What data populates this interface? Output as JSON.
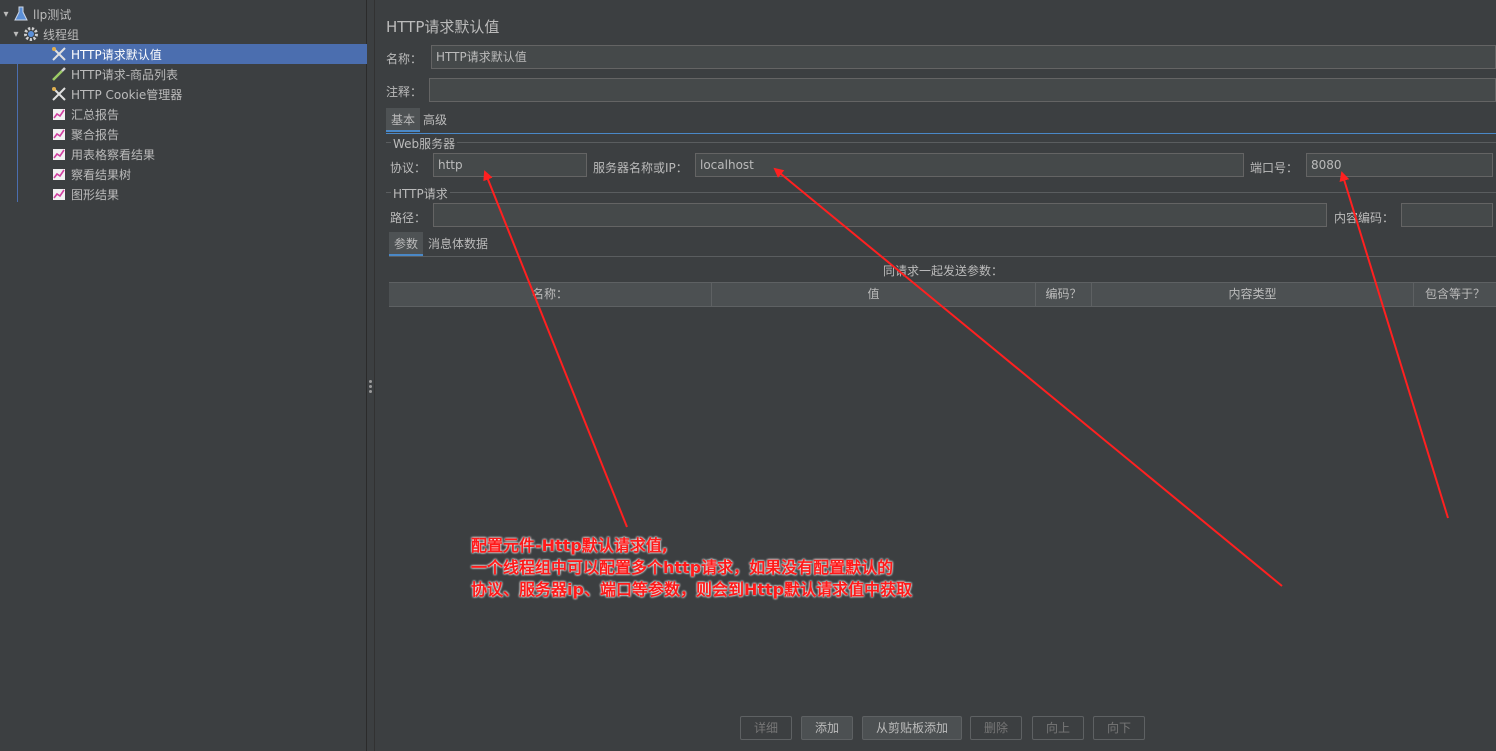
{
  "tree": {
    "items": [
      {
        "label": "llp测试",
        "icon": "test-plan-icon"
      },
      {
        "label": "线程组",
        "icon": "gear-icon"
      },
      {
        "label": "HTTP请求默认值",
        "icon": "wrench-icon"
      },
      {
        "label": "HTTP请求-商品列表",
        "icon": "pipette-icon"
      },
      {
        "label": "HTTP Cookie管理器",
        "icon": "wrench-icon"
      },
      {
        "label": "汇总报告",
        "icon": "graph-icon"
      },
      {
        "label": "聚合报告",
        "icon": "graph-icon"
      },
      {
        "label": "用表格察看结果",
        "icon": "graph-icon"
      },
      {
        "label": "察看结果树",
        "icon": "graph-icon"
      },
      {
        "label": "图形结果",
        "icon": "graph-icon"
      }
    ]
  },
  "panel": {
    "title": "HTTP请求默认值",
    "name_label": "名称：",
    "name_value": "HTTP请求默认值",
    "comment_label": "注释：",
    "comment_value": "",
    "tabs": [
      "基本",
      "高级"
    ],
    "web_server": {
      "group_title": "Web服务器",
      "protocol_label": "协议：",
      "protocol_value": "http",
      "server_label": "服务器名称或IP：",
      "server_value": "localhost",
      "port_label": "端口号：",
      "port_value": "8080"
    },
    "http_request": {
      "group_title": "HTTP请求",
      "path_label": "路径：",
      "path_value": "",
      "encoding_label": "内容编码：",
      "encoding_value": ""
    },
    "sub_tabs": [
      "参数",
      "消息体数据"
    ],
    "params_caption": "同请求一起发送参数：",
    "columns": [
      "名称：",
      "值",
      "编码？",
      "内容类型",
      "包含等于？"
    ],
    "buttons": [
      {
        "label": "详细",
        "enabled": false
      },
      {
        "label": "添加",
        "enabled": true
      },
      {
        "label": "从剪贴板添加",
        "enabled": true
      },
      {
        "label": "删除",
        "enabled": false
      },
      {
        "label": "向上",
        "enabled": false
      },
      {
        "label": "向下",
        "enabled": false
      }
    ]
  },
  "annotation": {
    "lines": [
      "配置元件-Http默认请求值,",
      "一个线程组中可以配置多个http请求，如果没有配置默认的",
      "协议、服务器ip、端口等参数，则会到Http默认请求值中获取"
    ],
    "color": "#ff1a1a"
  }
}
